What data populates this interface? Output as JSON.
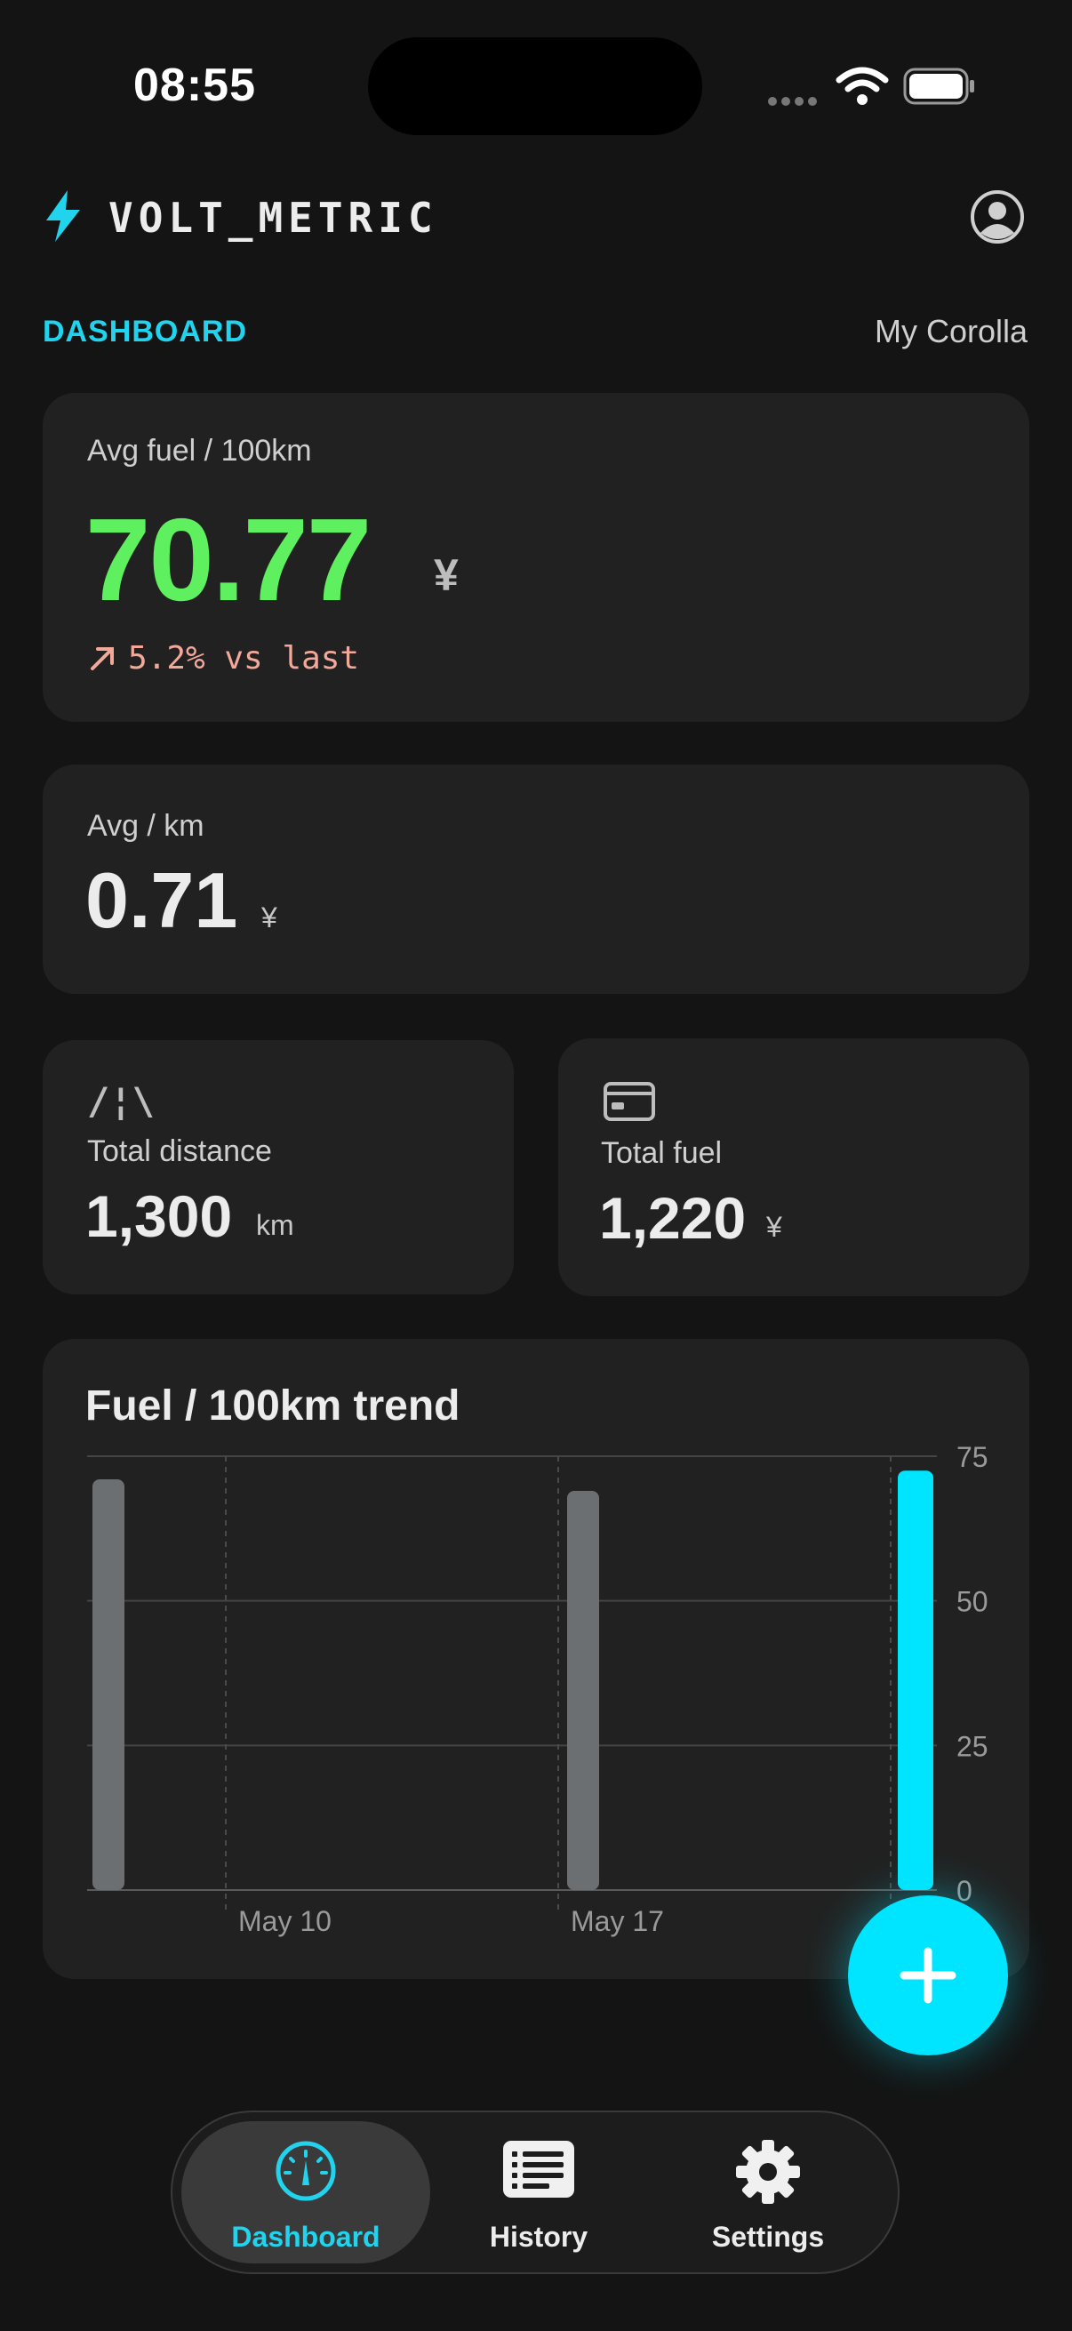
{
  "status": {
    "time": "08:55"
  },
  "header": {
    "brand": "VOLT_METRIC",
    "section": "DASHBOARD",
    "vehicle": "My Corolla"
  },
  "avg_fuel": {
    "label": "Avg fuel / 100km",
    "value": "70.77",
    "unit": "¥",
    "trend": "5.2% vs last"
  },
  "avg_km": {
    "label": "Avg / km",
    "value": "0.71",
    "unit": "¥"
  },
  "total_distance": {
    "label": "Total distance",
    "value": "1,300",
    "unit": "km",
    "icon_glyph": "/¦\\"
  },
  "total_fuel": {
    "label": "Total fuel",
    "value": "1,220",
    "unit": "¥"
  },
  "chart": {
    "title": "Fuel / 100km trend"
  },
  "chart_data": {
    "type": "bar",
    "title": "Fuel / 100km trend",
    "x_tick_labels": [
      "May 10",
      "May 17"
    ],
    "y_ticks": [
      "75",
      "50",
      "25",
      "0"
    ],
    "ylim": [
      0,
      75
    ],
    "grid": true,
    "y_axis_side": "right",
    "values": [
      71,
      69,
      72.5
    ],
    "highlight_index": 2,
    "colors": {
      "bar": "#6b6f72",
      "highlight": "#00e5ff"
    }
  },
  "nav": {
    "tabs": [
      {
        "label": "Dashboard",
        "icon": "gauge-icon",
        "active": true
      },
      {
        "label": "History",
        "icon": "list-icon",
        "active": false
      },
      {
        "label": "Settings",
        "icon": "gear-icon",
        "active": false
      }
    ]
  },
  "colors": {
    "accent": "#00e5ff",
    "positive": "#5ef05e",
    "trend": "#f4a89a",
    "background": "#141414",
    "card": "#212121"
  }
}
